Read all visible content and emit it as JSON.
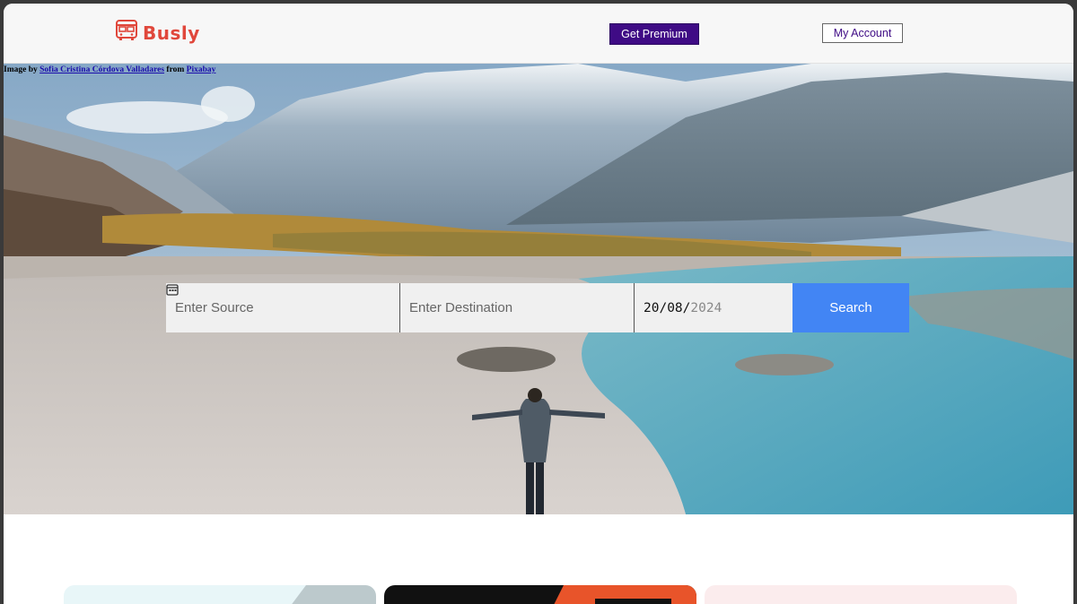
{
  "header": {
    "brand": "Busly",
    "premium_label": "Get Premium",
    "account_label": "My Account"
  },
  "hero": {
    "credit": {
      "prefix": "Image by ",
      "author": "Sofia Cristina Córdova Valladares",
      "middle": " from ",
      "site": "Pixabay"
    }
  },
  "search": {
    "source_placeholder": "Enter Source",
    "destination_placeholder": "Enter Destination",
    "date_day_month": "20/08/",
    "date_year": "2024",
    "button_label": "Search"
  },
  "colors": {
    "brand": "#e0473b",
    "premium": "#3f0b85",
    "search_button": "#4285f4"
  },
  "icons": [
    "bus-icon",
    "calendar-icon"
  ]
}
